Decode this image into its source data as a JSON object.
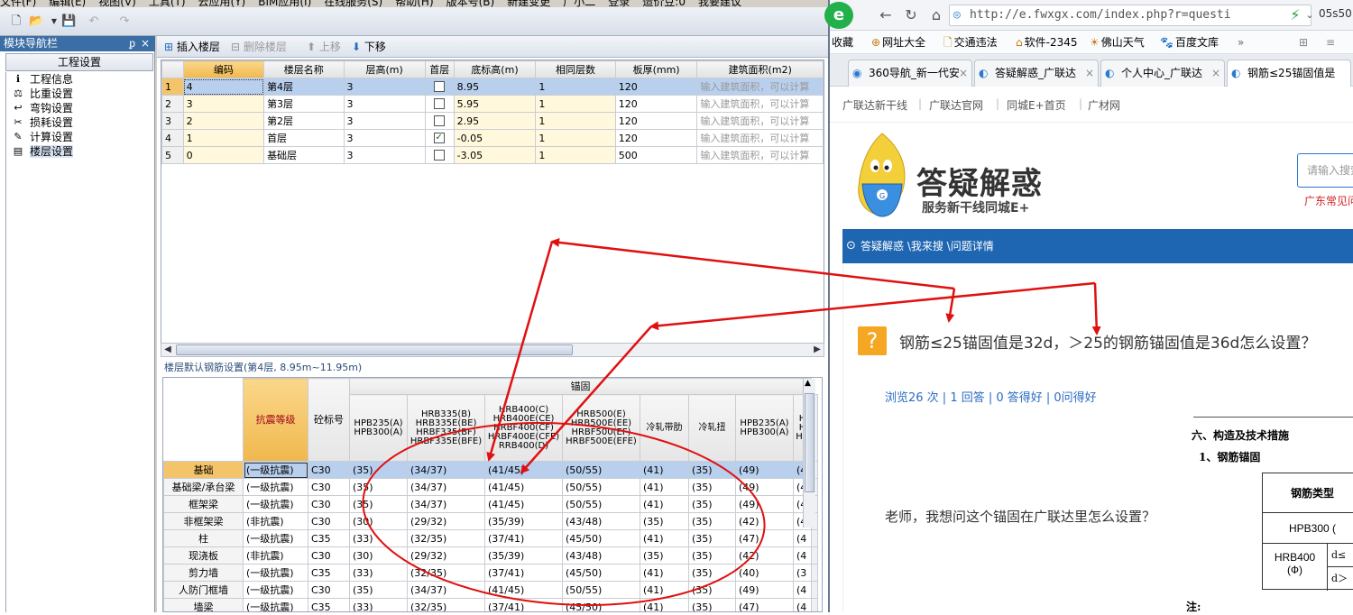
{
  "menu": {
    "items": [
      "文件(F)",
      "编辑(E)",
      "视图(V)",
      "工具(T)",
      "云应用(Y)",
      "BIM应用(I)",
      "在线服务(S)",
      "帮助(H)",
      "版本号(B)",
      "新建变更",
      "广小二",
      "登录",
      "造价豆:0",
      "我要建议"
    ]
  },
  "nav": {
    "title": "模块导航栏",
    "pin": "ᵱ",
    "close": "×",
    "section": "工程设置",
    "items": [
      {
        "label": "工程信息",
        "icon": "info-icon"
      },
      {
        "label": "比重设置",
        "icon": "weight-icon"
      },
      {
        "label": "弯钩设置",
        "icon": "hook-icon"
      },
      {
        "label": "损耗设置",
        "icon": "loss-icon"
      },
      {
        "label": "计算设置",
        "icon": "calc-icon"
      },
      {
        "label": "楼层设置",
        "icon": "floor-icon"
      }
    ]
  },
  "toolbar": {
    "insert": "插入楼层",
    "delete": "删除楼层",
    "up": "上移",
    "down": "下移"
  },
  "floors": {
    "headers": [
      "",
      "编码",
      "楼层名称",
      "层高(m)",
      "首层",
      "底标高(m)",
      "相同层数",
      "板厚(mm)",
      "建筑面积(m2)"
    ],
    "rows": [
      {
        "n": "1",
        "code": "4",
        "name": "第4层",
        "height": "3",
        "first": false,
        "base": "8.95",
        "same": "1",
        "slab": "120",
        "area": "输入建筑面积，可以计算"
      },
      {
        "n": "2",
        "code": "3",
        "name": "第3层",
        "height": "3",
        "first": false,
        "base": "5.95",
        "same": "1",
        "slab": "120",
        "area": "输入建筑面积，可以计算"
      },
      {
        "n": "3",
        "code": "2",
        "name": "第2层",
        "height": "3",
        "first": false,
        "base": "2.95",
        "same": "1",
        "slab": "120",
        "area": "输入建筑面积，可以计算"
      },
      {
        "n": "4",
        "code": "1",
        "name": "首层",
        "height": "3",
        "first": true,
        "base": "-0.05",
        "same": "1",
        "slab": "120",
        "area": "输入建筑面积，可以计算"
      },
      {
        "n": "5",
        "code": "0",
        "name": "基础层",
        "height": "3",
        "first": false,
        "base": "-3.05",
        "same": "1",
        "slab": "500",
        "area": "输入建筑面积，可以计算"
      }
    ]
  },
  "rebar": {
    "title": "楼层默认钢筋设置(第4层, 8.95m~11.95m)",
    "group": "锚固",
    "h_seismic": "抗震等级",
    "h_concrete": "砼标号",
    "cols": [
      "HPB235(A) HPB300(A)",
      "HRB335(B) HRB335E(BE) HRBF335(BF) HRBF335E(BFE)",
      "HRB400(C) HRB400E(CE) HRBF400(CF) HRBF400E(CFE) RRB400(D)",
      "HRB500(E) HRB500E(EE) HRBF500(EF) HRBF500E(EFE)",
      "冷轧带肋",
      "冷轧扭",
      "HPB235(A) HPB300(A)",
      "H H HR"
    ],
    "rows": [
      {
        "name": "基础",
        "seismic": "(一级抗震)",
        "c": "C30",
        "v": [
          "(35)",
          "(34/37)",
          "(41/45)",
          "(50/55)",
          "(41)",
          "(35)",
          "(49)",
          "(4"
        ]
      },
      {
        "name": "基础梁/承台梁",
        "seismic": "(一级抗震)",
        "c": "C30",
        "v": [
          "(35)",
          "(34/37)",
          "(41/45)",
          "(50/55)",
          "(41)",
          "(35)",
          "(49)",
          "(4"
        ]
      },
      {
        "name": "框架梁",
        "seismic": "(一级抗震)",
        "c": "C30",
        "v": [
          "(35)",
          "(34/37)",
          "(41/45)",
          "(50/55)",
          "(41)",
          "(35)",
          "(49)",
          "(4"
        ]
      },
      {
        "name": "非框架梁",
        "seismic": "(非抗震)",
        "c": "C30",
        "v": [
          "(30)",
          "(29/32)",
          "(35/39)",
          "(43/48)",
          "(35)",
          "(35)",
          "(42)",
          "(4"
        ]
      },
      {
        "name": "柱",
        "seismic": "(一级抗震)",
        "c": "C35",
        "v": [
          "(33)",
          "(32/35)",
          "(37/41)",
          "(45/50)",
          "(41)",
          "(35)",
          "(47)",
          "(4"
        ]
      },
      {
        "name": "现浇板",
        "seismic": "(非抗震)",
        "c": "C30",
        "v": [
          "(30)",
          "(29/32)",
          "(35/39)",
          "(43/48)",
          "(35)",
          "(35)",
          "(42)",
          "(4"
        ]
      },
      {
        "name": "剪力墙",
        "seismic": "(一级抗震)",
        "c": "C35",
        "v": [
          "(33)",
          "(32/35)",
          "(37/41)",
          "(45/50)",
          "(41)",
          "(35)",
          "(40)",
          "(3"
        ]
      },
      {
        "name": "人防门框墙",
        "seismic": "(一级抗震)",
        "c": "C30",
        "v": [
          "(35)",
          "(34/37)",
          "(41/45)",
          "(50/55)",
          "(41)",
          "(35)",
          "(49)",
          "(4"
        ]
      },
      {
        "name": "墙梁",
        "seismic": "(一级抗震)",
        "c": "C35",
        "v": [
          "(33)",
          "(32/35)",
          "(37/41)",
          "(45/50)",
          "(41)",
          "(35)",
          "(47)",
          "(4"
        ]
      }
    ]
  },
  "browser": {
    "url": "http://e.fwxgx.com/index.php?r=questi",
    "time": "05s50",
    "favorites": [
      "收藏",
      "网址大全",
      "交通违法",
      "软件-2345",
      "佛山天气",
      "百度文库"
    ],
    "tabs": [
      "360导航_新一代安",
      "答疑解惑_广联达",
      "个人中心_广联达",
      "钢筋≤25锚固值是"
    ],
    "sitenav": [
      "广联达新干线",
      "广联达官网",
      "同城E+首页",
      "广材网"
    ],
    "brand": "答疑解惑",
    "brand_sub": "服务新干线同城E+",
    "search_placeholder": "请输入搜索",
    "red_text": "广东常见问",
    "breadcrumb": "答疑解惑 \\我来搜 \\问题详情",
    "question": "钢筋≤25锚固值是32d，＞25的钢筋锚固值是36d怎么设置？",
    "stats": "浏览26 次 | 1 回答 | 0 答得好 | 0问得好",
    "ask": "老师，我想问这个锚固在广联达里怎么设置？",
    "doc": {
      "h1": "六、构造及技术措施",
      "h2": "1、钢筋锚固",
      "th": "钢筋类型",
      "r1": "HPB300 (",
      "r2a": "HRB400",
      "r2b": "(Ф)",
      "d1": "d≤",
      "d2": "d＞",
      "note": "注:"
    }
  },
  "colors": {
    "annotation": "#e01010",
    "selected_row": "#b8cfee",
    "header_highlight": "#f4c46a",
    "brand_blue": "#1f66b2"
  }
}
